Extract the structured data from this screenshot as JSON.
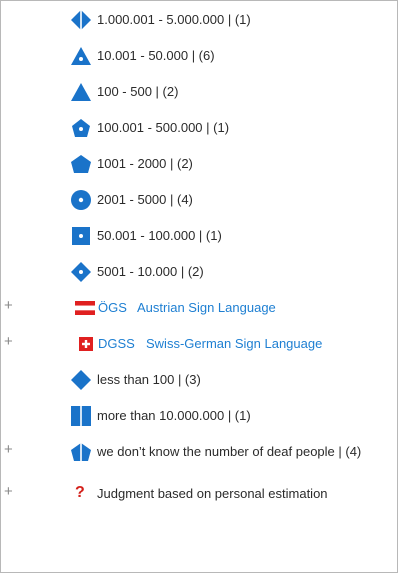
{
  "legend": {
    "items": [
      {
        "label": "1.000.001 - 5.000.000 | (1)",
        "icon": "split-diamond-icon"
      },
      {
        "label": "10.001 - 50.000 | (6)",
        "icon": "triangle-dot-icon"
      },
      {
        "label": "100 - 500 | (2)",
        "icon": "triangle-icon"
      },
      {
        "label": "100.001 - 500.000 | (1)",
        "icon": "pentagon-dot-icon"
      },
      {
        "label": "1001 - 2000 | (2)",
        "icon": "pentagon-icon"
      },
      {
        "label": "2001 - 5000 | (4)",
        "icon": "circle-dot-icon"
      },
      {
        "label": "50.001 - 100.000 | (1)",
        "icon": "square-dot-icon"
      },
      {
        "label": "5001 - 10.000 | (2)",
        "icon": "diamond-dot-icon"
      }
    ],
    "languages": [
      {
        "code": "ÖGS",
        "name": "Austrian Sign Language",
        "icon": "austria-flag-icon"
      },
      {
        "code": "DGSS",
        "name": "Swiss-German Sign Language",
        "icon": "swiss-flag-icon"
      }
    ],
    "items2": [
      {
        "label": "less than 100 | (3)",
        "icon": "diamond-icon"
      },
      {
        "label": "more than 10.000.000 | (1)",
        "icon": "split-square-icon"
      },
      {
        "label": "we don’t know the number of deaf people | (4)",
        "icon": "split-pentagon-icon"
      }
    ],
    "note": {
      "symbol": "?",
      "label": "Judgment based on personal estimation"
    },
    "toggle": "+"
  },
  "colors": {
    "accent": "#1e7fd2",
    "icon_blue": "#1a73c9",
    "red": "#d4201a"
  }
}
